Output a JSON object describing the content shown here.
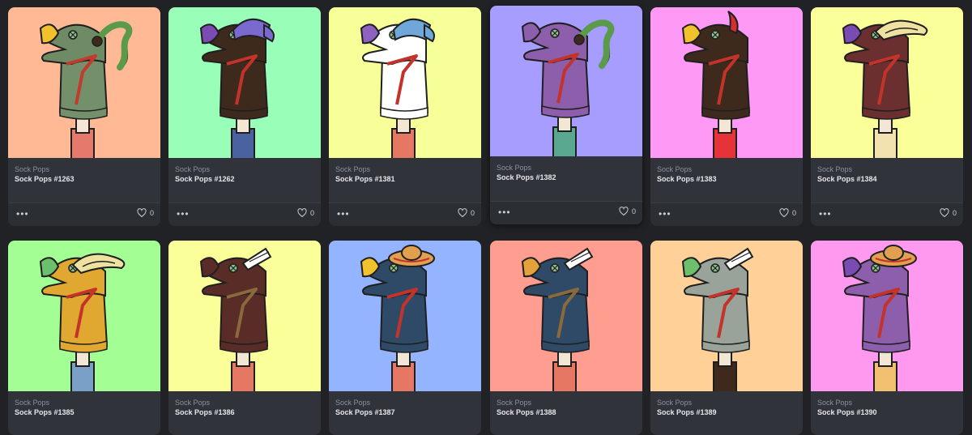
{
  "cards": [
    {
      "collection": "Sock Pops",
      "name": "Sock Pops #1263",
      "likes": "0",
      "bg": "#ffb994",
      "sock": "#73906a",
      "head": "#6e8b66",
      "beak": "#f2c12e",
      "hat": "horns-green",
      "tie": "#c43b2e",
      "pants": "#e57a6c"
    },
    {
      "collection": "Sock Pops",
      "name": "Sock Pops #1262",
      "likes": "0",
      "bg": "#99ffb8",
      "sock": "#3e2a1c",
      "head": "#3e2a1c",
      "beak": "#7a4bb3",
      "hat": "cap-purple",
      "tie": "#c4332a",
      "pants": "#4a62a0"
    },
    {
      "collection": "Sock Pops",
      "name": "Sock Pops #1381",
      "likes": "0",
      "bg": "#f7ff99",
      "sock": "#ffffff",
      "head": "#ffffff",
      "beak": "#8f62c2",
      "hat": "cap-blue",
      "tie": "#c4332a",
      "pants": "#e67863"
    },
    {
      "collection": "Sock Pops",
      "name": "Sock Pops #1382",
      "likes": "0",
      "bg": "#a79cff",
      "sock": "#8c5eac",
      "head": "#8c5eac",
      "beak": "#8c5eac",
      "hat": "horns-green",
      "tie": "#c4332a",
      "pants": "#5aa88f"
    },
    {
      "collection": "Sock Pops",
      "name": "Sock Pops #1383",
      "likes": "0",
      "bg": "#ff99f6",
      "sock": "#3e2a1c",
      "head": "#3e2a1c",
      "beak": "#f2c12e",
      "hat": "horn-red",
      "tie": "#c4332a",
      "pants": "#e6333a"
    },
    {
      "collection": "Sock Pops",
      "name": "Sock Pops #1384",
      "likes": "0",
      "bg": "#fbff99",
      "sock": "#6b2f2f",
      "head": "#6b2f2f",
      "beak": "#7a4bb3",
      "hat": "straw",
      "tie": "#c4332a",
      "pants": "#f1e2b0"
    },
    {
      "collection": "Sock Pops",
      "name": "Sock Pops #1385",
      "likes": "",
      "bg": "#a3ff94",
      "sock": "#e0a830",
      "head": "#e0a830",
      "beak": "#6cc06c",
      "hat": "straw",
      "tie": "#c4332a",
      "pants": "#7aa0c8"
    },
    {
      "collection": "Sock Pops",
      "name": "Sock Pops #1386",
      "likes": "",
      "bg": "#fbff99",
      "sock": "#5a2c28",
      "head": "#5a2c28",
      "beak": "#5a2c28",
      "hat": "chef",
      "tie": "#8a6a3a",
      "pants": "#e67863"
    },
    {
      "collection": "Sock Pops",
      "name": "Sock Pops #1387",
      "likes": "",
      "bg": "#94b4ff",
      "sock": "#2e4a66",
      "head": "#2e4a66",
      "beak": "#f2c12e",
      "hat": "sombrero",
      "tie": "#c4332a",
      "pants": "#e67863"
    },
    {
      "collection": "Sock Pops",
      "name": "Sock Pops #1388",
      "likes": "",
      "bg": "#ff9d90",
      "sock": "#2e4a66",
      "head": "#2e4a66",
      "beak": "#e6a23a",
      "hat": "chef",
      "tie": "#8a6a3a",
      "pants": "#e67863"
    },
    {
      "collection": "Sock Pops",
      "name": "Sock Pops #1389",
      "likes": "",
      "bg": "#ffd199",
      "sock": "#9aa39a",
      "head": "#9aa39a",
      "beak": "#6cc06c",
      "hat": "chef",
      "tie": "#c4332a",
      "pants": "#3e2a1c"
    },
    {
      "collection": "Sock Pops",
      "name": "Sock Pops #1390",
      "likes": "",
      "bg": "#ff99f0",
      "sock": "#8c5eac",
      "head": "#8c5eac",
      "beak": "#7a4bb3",
      "hat": "sombrero",
      "tie": "#c4332a",
      "pants": "#f1c070"
    }
  ],
  "icons": {
    "more": "more-dots-icon",
    "like": "heart-icon"
  },
  "labels": {
    "more": "•••"
  }
}
